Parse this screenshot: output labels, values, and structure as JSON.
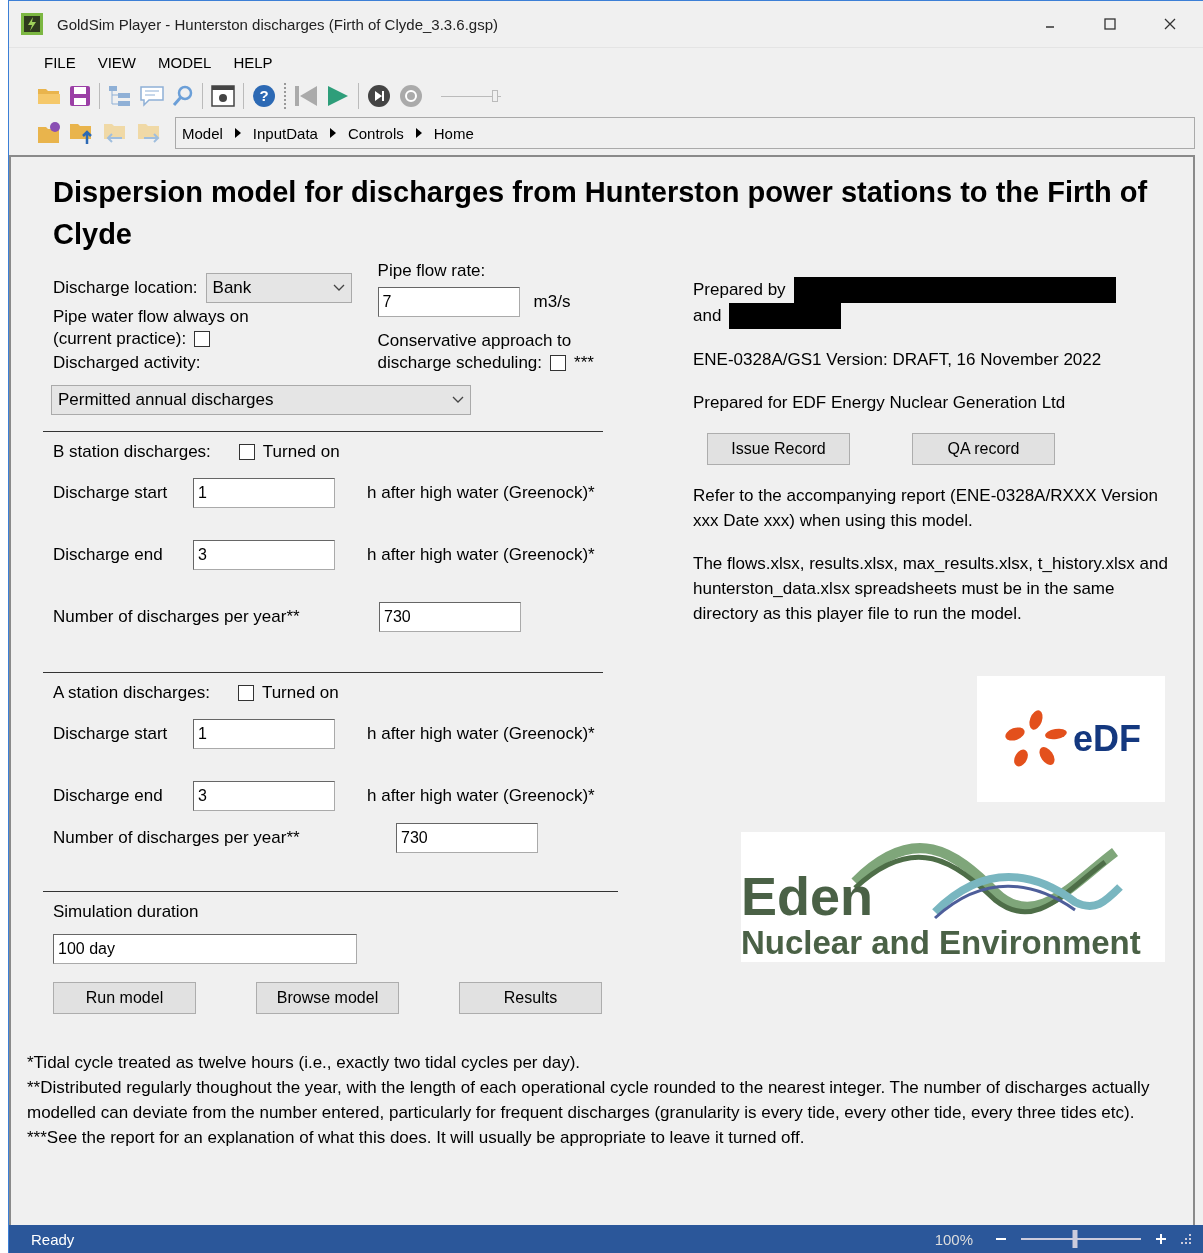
{
  "window": {
    "title": "GoldSim Player - Hunterston discharges (Firth of Clyde_3.3.6.gsp)"
  },
  "menu": [
    "FILE",
    "VIEW",
    "MODEL",
    "HELP"
  ],
  "breadcrumb": [
    "Model",
    "InputData",
    "Controls",
    "Home"
  ],
  "toolbar": {
    "help_glyph": "?",
    "speed": {
      "level": 0.9
    }
  },
  "heading": "Dispersion model for discharges from Hunterston power stations to the Firth of Clyde",
  "discharge_location": {
    "label": "Discharge location:",
    "value": "Bank"
  },
  "pipe_flow": {
    "label": "Pipe flow rate:",
    "value": "7",
    "unit": "m3/s"
  },
  "pipe_always_on": {
    "label_1": "Pipe water flow always on",
    "label_2": "(current practice):",
    "checked": false
  },
  "conservative": {
    "label_1": "Conservative approach to",
    "label_2": "discharge scheduling:",
    "checked": false,
    "note": "***"
  },
  "discharged_activity": {
    "label": "Discharged activity:",
    "value": "Permitted annual discharges"
  },
  "stations": [
    {
      "label": "B station discharges:",
      "toggle": {
        "label": "Turned on",
        "checked": false
      },
      "start": {
        "label": "Discharge start",
        "value": "1",
        "suffix": "h after high water (Greenock)*"
      },
      "end": {
        "label": "Discharge end",
        "value": "3",
        "suffix": "h after high water (Greenock)*"
      },
      "count": {
        "label": "Number of discharges per year**",
        "value": "730"
      }
    },
    {
      "label": "A station discharges:",
      "toggle": {
        "label": "Turned on",
        "checked": false
      },
      "start": {
        "label": "Discharge start",
        "value": "1",
        "suffix": "h after high water (Greenock)*"
      },
      "end": {
        "label": "Discharge end",
        "value": "3",
        "suffix": "h after high water (Greenock)*"
      },
      "count": {
        "label": "Number of discharges per year**",
        "value": "730"
      }
    }
  ],
  "simulation": {
    "label": "Simulation duration",
    "value": "100 day"
  },
  "actions": [
    "Run model",
    "Browse model",
    "Results"
  ],
  "info": {
    "prepared_by": "Prepared by",
    "and": "and",
    "version": "ENE-0328A/GS1 Version: DRAFT, 16 November 2022",
    "prepared_for": "Prepared for EDF Energy Nuclear Generation Ltd",
    "buttons": [
      "Issue Record",
      "QA record"
    ],
    "refer": "Refer to the accompanying report (ENE-0328A/RXXX Version xxx Date xxx) when using this model.",
    "files": "The flows.xlsx, results.xlsx, max_results.xlsx, t_history.xlsx and hunterston_data.xlsx spreadsheets must be in the same directory as this player file to run the model."
  },
  "logos": {
    "edf": "eDF",
    "eden": "Eden",
    "eden_sub": "Nuclear and Environment"
  },
  "notes": [
    "*Tidal cycle treated as twelve hours (i.e., exactly two tidal cycles per day).",
    "**Distributed regularly thoughout the year, with the length of each operational cycle rounded to the nearest integer. The number of discharges actually modelled can deviate from the number entered, particularly for frequent discharges (granularity is every tide, every other tide, every three tides etc).",
    "***See the report for an explanation of what this does. It will usually be appropriate to leave it turned off."
  ],
  "status_bar": {
    "text": "Ready",
    "zoom": "100%",
    "zoom_slider": {
      "level": 0.45
    }
  }
}
